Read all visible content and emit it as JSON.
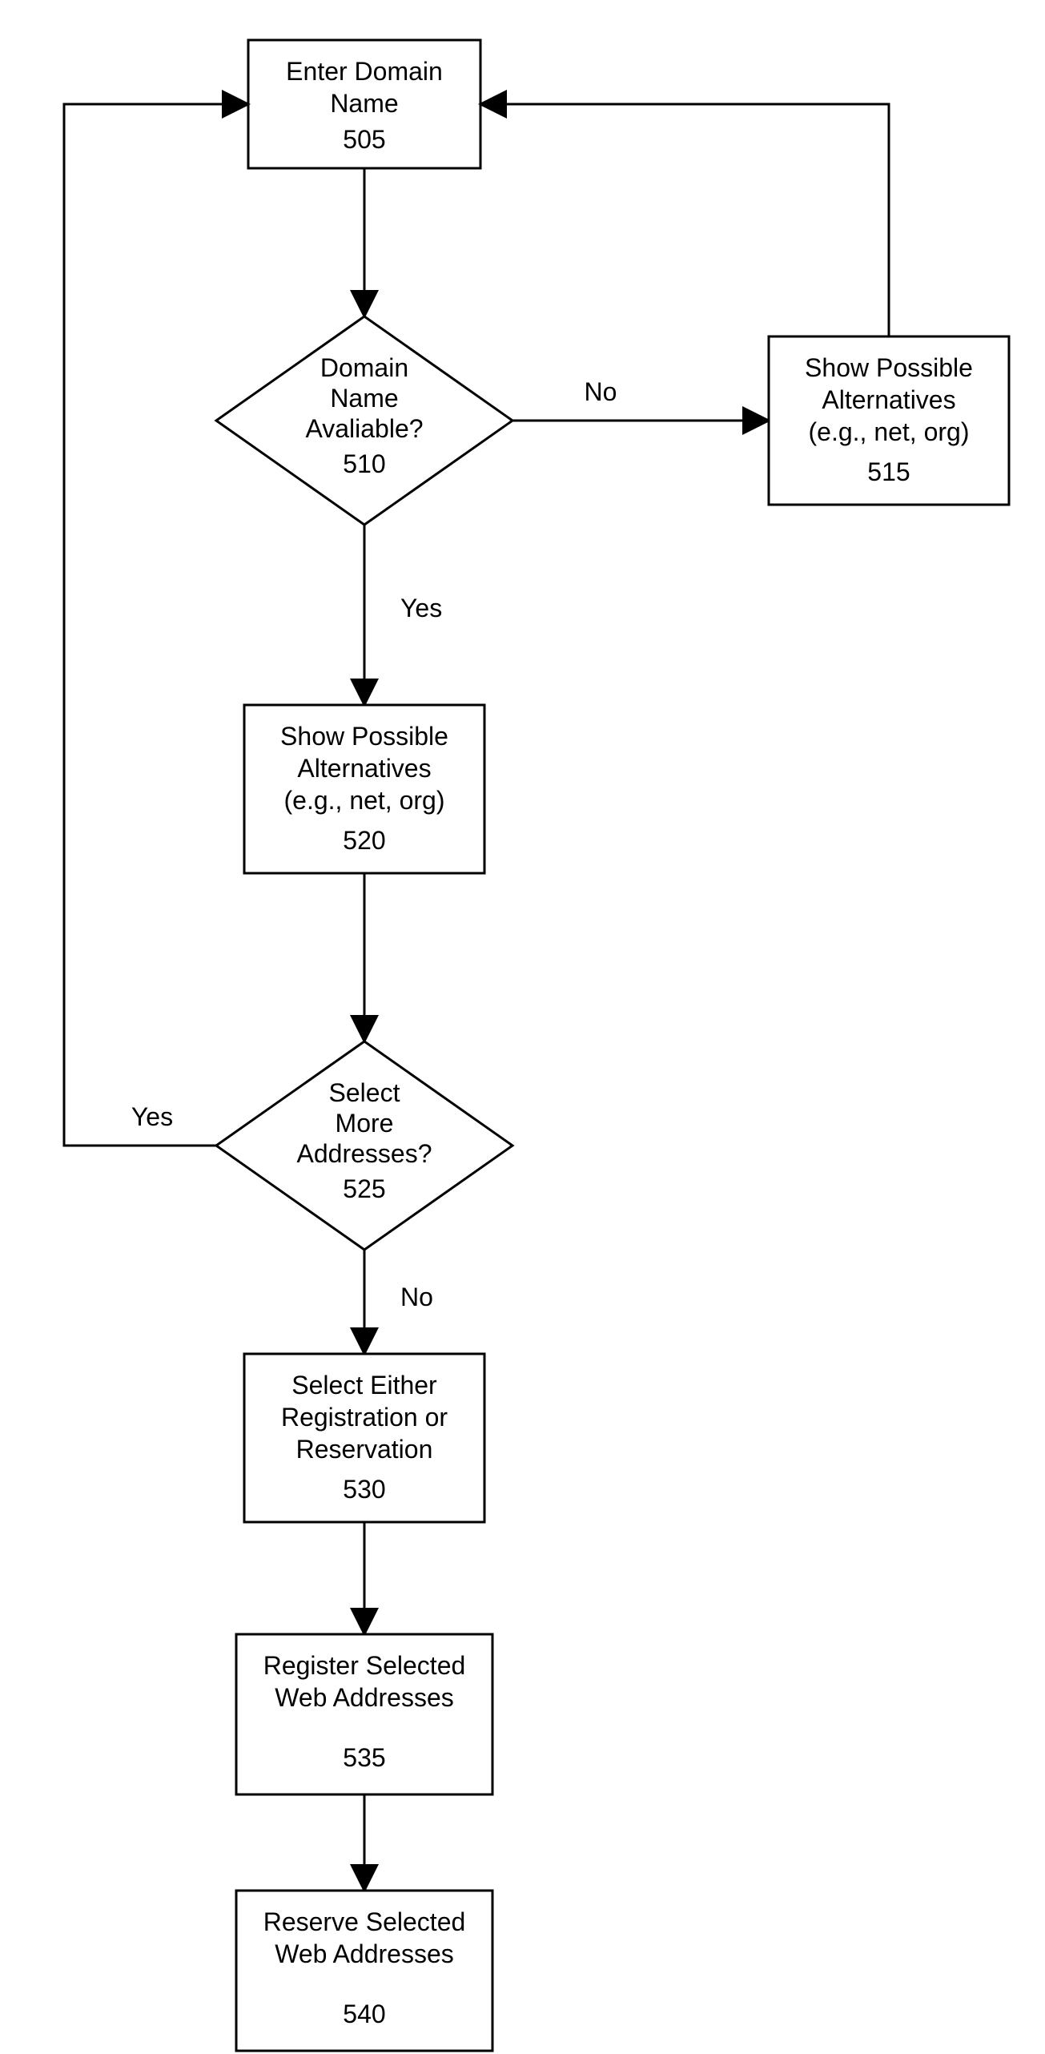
{
  "nodes": {
    "n505": {
      "l1": "Enter Domain",
      "l2": "Name",
      "num": "505"
    },
    "n510": {
      "l1": "Domain",
      "l2": "Name",
      "l3": "Avaliable?",
      "num": "510"
    },
    "n515": {
      "l1": "Show Possible",
      "l2": "Alternatives",
      "l3": "(e.g., net, org)",
      "num": "515"
    },
    "n520": {
      "l1": "Show Possible",
      "l2": "Alternatives",
      "l3": "(e.g., net, org)",
      "num": "520"
    },
    "n525": {
      "l1": "Select",
      "l2": "More",
      "l3": "Addresses?",
      "num": "525"
    },
    "n530": {
      "l1": "Select Either",
      "l2": "Registration or",
      "l3": "Reservation",
      "num": "530"
    },
    "n535": {
      "l1": "Register Selected",
      "l2": "Web Addresses",
      "num": "535"
    },
    "n540": {
      "l1": "Reserve Selected",
      "l2": "Web Addresses",
      "num": "540"
    }
  },
  "labels": {
    "yes1": "Yes",
    "no1": "No",
    "yes2": "Yes",
    "no2": "No"
  }
}
